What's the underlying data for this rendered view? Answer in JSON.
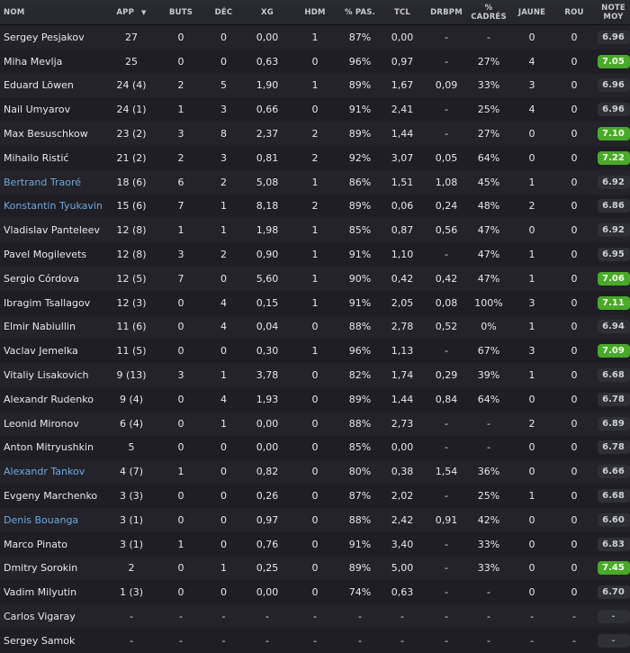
{
  "headers": {
    "nom": "NOM",
    "app": "APP",
    "buts": "BUTS",
    "dec": "DÉC",
    "xg": "XG",
    "hdm": "HDM",
    "pas": "% PAS.",
    "tcl": "TCL",
    "drb": "DRBPM",
    "cad": "% CADRÉS",
    "jaune": "JAUNE",
    "rou": "ROU",
    "note": "NOTE MOY"
  },
  "sort_icon": "▼",
  "rows": [
    {
      "name": "Sergey Pesjakov",
      "app": "27",
      "buts": "0",
      "dec": "0",
      "xg": "0,00",
      "hdm": "1",
      "pas": "87%",
      "tcl": "0,00",
      "drb": "-",
      "cad": "-",
      "jaune": "0",
      "rou": "0",
      "note": "6.96",
      "green": false,
      "link": false
    },
    {
      "name": "Miha Mevlja",
      "app": "25",
      "buts": "0",
      "dec": "0",
      "xg": "0,63",
      "hdm": "0",
      "pas": "96%",
      "tcl": "0,97",
      "drb": "-",
      "cad": "27%",
      "jaune": "4",
      "rou": "0",
      "note": "7.05",
      "green": true,
      "link": false
    },
    {
      "name": "Eduard Löwen",
      "app": "24 (4)",
      "buts": "2",
      "dec": "5",
      "xg": "1,90",
      "hdm": "1",
      "pas": "89%",
      "tcl": "1,67",
      "drb": "0,09",
      "cad": "33%",
      "jaune": "3",
      "rou": "0",
      "note": "6.96",
      "green": false,
      "link": false
    },
    {
      "name": "Nail Umyarov",
      "app": "24 (1)",
      "buts": "1",
      "dec": "3",
      "xg": "0,66",
      "hdm": "0",
      "pas": "91%",
      "tcl": "2,41",
      "drb": "-",
      "cad": "25%",
      "jaune": "4",
      "rou": "0",
      "note": "6.96",
      "green": false,
      "link": false
    },
    {
      "name": "Max Besuschkow",
      "app": "23 (2)",
      "buts": "3",
      "dec": "8",
      "xg": "2,37",
      "hdm": "2",
      "pas": "89%",
      "tcl": "1,44",
      "drb": "-",
      "cad": "27%",
      "jaune": "0",
      "rou": "0",
      "note": "7.10",
      "green": true,
      "link": false
    },
    {
      "name": "Mihailo Ristić",
      "app": "21 (2)",
      "buts": "2",
      "dec": "3",
      "xg": "0,81",
      "hdm": "2",
      "pas": "92%",
      "tcl": "3,07",
      "drb": "0,05",
      "cad": "64%",
      "jaune": "0",
      "rou": "0",
      "note": "7.22",
      "green": true,
      "link": false
    },
    {
      "name": "Bertrand Traoré",
      "app": "18 (6)",
      "buts": "6",
      "dec": "2",
      "xg": "5,08",
      "hdm": "1",
      "pas": "86%",
      "tcl": "1,51",
      "drb": "1,08",
      "cad": "45%",
      "jaune": "1",
      "rou": "0",
      "note": "6.92",
      "green": false,
      "link": true
    },
    {
      "name": "Konstantin Tyukavin",
      "app": "15 (6)",
      "buts": "7",
      "dec": "1",
      "xg": "8,18",
      "hdm": "2",
      "pas": "89%",
      "tcl": "0,06",
      "drb": "0,24",
      "cad": "48%",
      "jaune": "2",
      "rou": "0",
      "note": "6.86",
      "green": false,
      "link": true
    },
    {
      "name": "Vladislav Panteleev",
      "app": "12 (8)",
      "buts": "1",
      "dec": "1",
      "xg": "1,98",
      "hdm": "1",
      "pas": "85%",
      "tcl": "0,87",
      "drb": "0,56",
      "cad": "47%",
      "jaune": "0",
      "rou": "0",
      "note": "6.92",
      "green": false,
      "link": false
    },
    {
      "name": "Pavel Mogilevets",
      "app": "12 (8)",
      "buts": "3",
      "dec": "2",
      "xg": "0,90",
      "hdm": "1",
      "pas": "91%",
      "tcl": "1,10",
      "drb": "-",
      "cad": "47%",
      "jaune": "1",
      "rou": "0",
      "note": "6.95",
      "green": false,
      "link": false
    },
    {
      "name": "Sergio Córdova",
      "app": "12 (5)",
      "buts": "7",
      "dec": "0",
      "xg": "5,60",
      "hdm": "1",
      "pas": "90%",
      "tcl": "0,42",
      "drb": "0,42",
      "cad": "47%",
      "jaune": "1",
      "rou": "0",
      "note": "7.06",
      "green": true,
      "link": false
    },
    {
      "name": "Ibragim Tsallagov",
      "app": "12 (3)",
      "buts": "0",
      "dec": "4",
      "xg": "0,15",
      "hdm": "1",
      "pas": "91%",
      "tcl": "2,05",
      "drb": "0,08",
      "cad": "100%",
      "jaune": "3",
      "rou": "0",
      "note": "7.11",
      "green": true,
      "link": false
    },
    {
      "name": "Elmir Nabiullin",
      "app": "11 (6)",
      "buts": "0",
      "dec": "4",
      "xg": "0,04",
      "hdm": "0",
      "pas": "88%",
      "tcl": "2,78",
      "drb": "0,52",
      "cad": "0%",
      "jaune": "1",
      "rou": "0",
      "note": "6.94",
      "green": false,
      "link": false
    },
    {
      "name": "Vaclav Jemelka",
      "app": "11 (5)",
      "buts": "0",
      "dec": "0",
      "xg": "0,30",
      "hdm": "1",
      "pas": "96%",
      "tcl": "1,13",
      "drb": "-",
      "cad": "67%",
      "jaune": "3",
      "rou": "0",
      "note": "7.09",
      "green": true,
      "link": false
    },
    {
      "name": "Vitaliy Lisakovich",
      "app": "9 (13)",
      "buts": "3",
      "dec": "1",
      "xg": "3,78",
      "hdm": "0",
      "pas": "82%",
      "tcl": "1,74",
      "drb": "0,29",
      "cad": "39%",
      "jaune": "1",
      "rou": "0",
      "note": "6.68",
      "green": false,
      "link": false
    },
    {
      "name": "Alexandr Rudenko",
      "app": "9 (4)",
      "buts": "0",
      "dec": "4",
      "xg": "1,93",
      "hdm": "0",
      "pas": "89%",
      "tcl": "1,44",
      "drb": "0,84",
      "cad": "64%",
      "jaune": "0",
      "rou": "0",
      "note": "6.78",
      "green": false,
      "link": false
    },
    {
      "name": "Leonid Mironov",
      "app": "6 (4)",
      "buts": "0",
      "dec": "1",
      "xg": "0,00",
      "hdm": "0",
      "pas": "88%",
      "tcl": "2,73",
      "drb": "-",
      "cad": "-",
      "jaune": "2",
      "rou": "0",
      "note": "6.89",
      "green": false,
      "link": false
    },
    {
      "name": "Anton Mitryushkin",
      "app": "5",
      "buts": "0",
      "dec": "0",
      "xg": "0,00",
      "hdm": "0",
      "pas": "85%",
      "tcl": "0,00",
      "drb": "-",
      "cad": "-",
      "jaune": "0",
      "rou": "0",
      "note": "6.78",
      "green": false,
      "link": false
    },
    {
      "name": "Alexandr Tankov",
      "app": "4 (7)",
      "buts": "1",
      "dec": "0",
      "xg": "0,82",
      "hdm": "0",
      "pas": "80%",
      "tcl": "0,38",
      "drb": "1,54",
      "cad": "36%",
      "jaune": "0",
      "rou": "0",
      "note": "6.66",
      "green": false,
      "link": true
    },
    {
      "name": "Evgeny Marchenko",
      "app": "3 (3)",
      "buts": "0",
      "dec": "0",
      "xg": "0,26",
      "hdm": "0",
      "pas": "87%",
      "tcl": "2,02",
      "drb": "-",
      "cad": "25%",
      "jaune": "1",
      "rou": "0",
      "note": "6.68",
      "green": false,
      "link": false
    },
    {
      "name": "Denis Bouanga",
      "app": "3 (1)",
      "buts": "0",
      "dec": "0",
      "xg": "0,97",
      "hdm": "0",
      "pas": "88%",
      "tcl": "2,42",
      "drb": "0,91",
      "cad": "42%",
      "jaune": "0",
      "rou": "0",
      "note": "6.60",
      "green": false,
      "link": true
    },
    {
      "name": "Marco Pinato",
      "app": "3 (1)",
      "buts": "1",
      "dec": "0",
      "xg": "0,76",
      "hdm": "0",
      "pas": "91%",
      "tcl": "3,40",
      "drb": "-",
      "cad": "33%",
      "jaune": "0",
      "rou": "0",
      "note": "6.83",
      "green": false,
      "link": false
    },
    {
      "name": "Dmitry Sorokin",
      "app": "2",
      "buts": "0",
      "dec": "1",
      "xg": "0,25",
      "hdm": "0",
      "pas": "89%",
      "tcl": "5,00",
      "drb": "-",
      "cad": "33%",
      "jaune": "0",
      "rou": "0",
      "note": "7.45",
      "green": true,
      "link": false
    },
    {
      "name": "Vadim Milyutin",
      "app": "1 (3)",
      "buts": "0",
      "dec": "0",
      "xg": "0,00",
      "hdm": "0",
      "pas": "74%",
      "tcl": "0,63",
      "drb": "-",
      "cad": "-",
      "jaune": "0",
      "rou": "0",
      "note": "6.70",
      "green": false,
      "link": false
    },
    {
      "name": "Carlos Vigaray",
      "app": "-",
      "buts": "-",
      "dec": "-",
      "xg": "-",
      "hdm": "-",
      "pas": "-",
      "tcl": "-",
      "drb": "-",
      "cad": "-",
      "jaune": "-",
      "rou": "-",
      "note": "-",
      "green": false,
      "link": false
    },
    {
      "name": "Sergey Samok",
      "app": "-",
      "buts": "-",
      "dec": "-",
      "xg": "-",
      "hdm": "-",
      "pas": "-",
      "tcl": "-",
      "drb": "-",
      "cad": "-",
      "jaune": "-",
      "rou": "-",
      "note": "-",
      "green": false,
      "link": false
    }
  ]
}
